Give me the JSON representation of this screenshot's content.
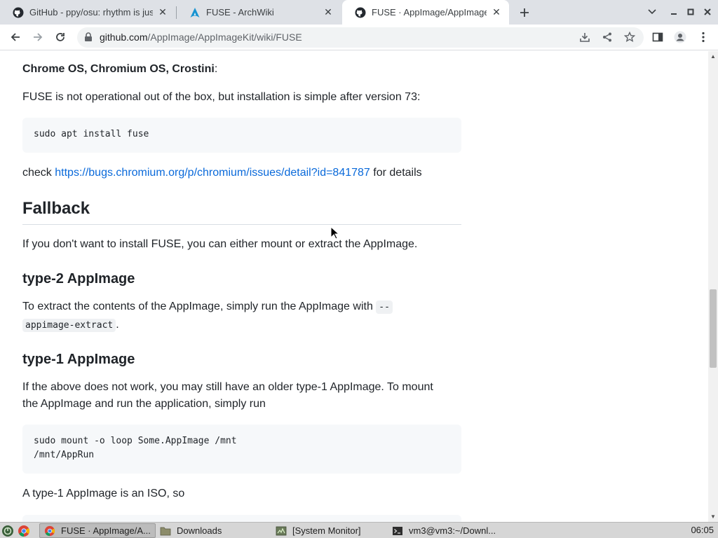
{
  "tabs": [
    {
      "title": "GitHub - ppy/osu: rhythm is just",
      "icon": "github-icon",
      "active": false
    },
    {
      "title": "FUSE - ArchWiki",
      "icon": "archlinux-icon",
      "active": false
    },
    {
      "title": "FUSE · AppImage/AppImageKit",
      "icon": "github-icon",
      "active": true
    }
  ],
  "toolbar": {
    "url_host": "github.com",
    "url_path": "/AppImage/AppImageKit/wiki/FUSE"
  },
  "content": {
    "chrome_heading": "Chrome OS, Chromium OS, Crostini",
    "chrome_heading_colon": ":",
    "chrome_text": "FUSE is not operational out of the box, but installation is simple after version 73:",
    "code1": [
      "sudo apt install fuse"
    ],
    "check_prefix": "check ",
    "check_link": "https://bugs.chromium.org/p/chromium/issues/detail?id=841787",
    "check_suffix": " for details",
    "fallback_heading": "Fallback",
    "fallback_text": "If you don't want to install FUSE, you can either mount or extract the AppImage.",
    "type2_heading": "type-2 AppImage",
    "type2_text_prefix": "To extract the contents of the AppImage, simply run the AppImage with ",
    "type2_code_a": "--",
    "type2_code_b": "appimage-extract",
    "type2_text_suffix": ".",
    "type1_heading": "type-1 AppImage",
    "type1_text_line1": "If the above does not work, you may still have an older type-1 AppImage. To mount",
    "type1_text_line2": "the AppImage and run the application, simply run",
    "code2": [
      "sudo mount -o loop Some.AppImage /mnt",
      "/mnt/AppRun"
    ],
    "iso_text": "A type-1 AppImage is an ISO, so"
  },
  "taskbar": {
    "items": [
      {
        "label": "FUSE · AppImage/A...",
        "icon": "chrome-icon",
        "active": true
      },
      {
        "label": "Downloads",
        "icon": "folder-icon",
        "active": false
      },
      {
        "label": "[System Monitor]",
        "icon": "system-monitor-icon",
        "active": false
      },
      {
        "label": "vm3@vm3:~/Downl...",
        "icon": "terminal-icon",
        "active": false
      }
    ],
    "clock": "06:05"
  },
  "colors": {
    "link": "#0969da",
    "tabstrip": "#dee1e6",
    "code_bg": "#f6f8fa"
  }
}
